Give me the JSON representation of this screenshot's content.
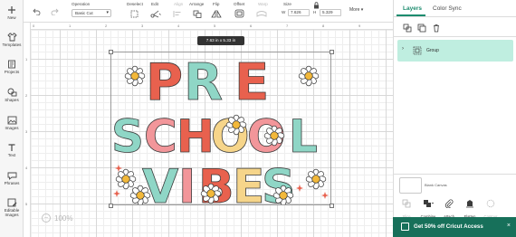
{
  "sidebar": {
    "items": [
      {
        "label": "New",
        "icon": "plus-icon"
      },
      {
        "label": "Templates",
        "icon": "shirt-icon"
      },
      {
        "label": "Projects",
        "icon": "folder-icon"
      },
      {
        "label": "Shapes",
        "icon": "shapes-icon"
      },
      {
        "label": "Images",
        "icon": "image-icon"
      },
      {
        "label": "Text",
        "icon": "text-icon"
      },
      {
        "label": "Phrases",
        "icon": "phrases-icon"
      },
      {
        "label": "Editable Images",
        "icon": "editable-image-icon"
      }
    ]
  },
  "toolbar": {
    "operation_label": "Operation",
    "operation_value": "Basic Cut",
    "deselect_label": "Deselect",
    "edit_label": "Edit",
    "align_label": "Align",
    "arrange_label": "Arrange",
    "flip_label": "Flip",
    "offset_label": "Offset",
    "warp_label": "Warp",
    "size_label": "Size",
    "w_label": "W",
    "w_value": "7.626",
    "h_label": "H",
    "h_value": "5.329",
    "more_label": "More ▾"
  },
  "canvas": {
    "ruler_top": [
      "0",
      "1",
      "2",
      "3",
      "4",
      "5",
      "6",
      "7",
      "8",
      "9"
    ],
    "ruler_left": [
      "1",
      "2",
      "3",
      "4",
      "5"
    ],
    "dimension_tooltip": "7.63  in x 5.33  in",
    "zoom_level": "100%",
    "design_lines": [
      "PRE",
      "SCHOOL",
      "VIBES"
    ],
    "colors": {
      "red": "#e8614e",
      "teal": "#8fd6c6",
      "pink": "#f2969a",
      "yellow": "#f6d58a",
      "outline": "#2f2f2f"
    }
  },
  "panel": {
    "tab_layers": "Layers",
    "tab_color_sync": "Color Sync",
    "layer_name": "Group",
    "blank_canvas": "Blank Canvas",
    "bottom_tools": [
      "Slice",
      "Combine",
      "Attach",
      "Flatten",
      "Contour"
    ],
    "promo": "Get 50% off Cricut Access"
  }
}
